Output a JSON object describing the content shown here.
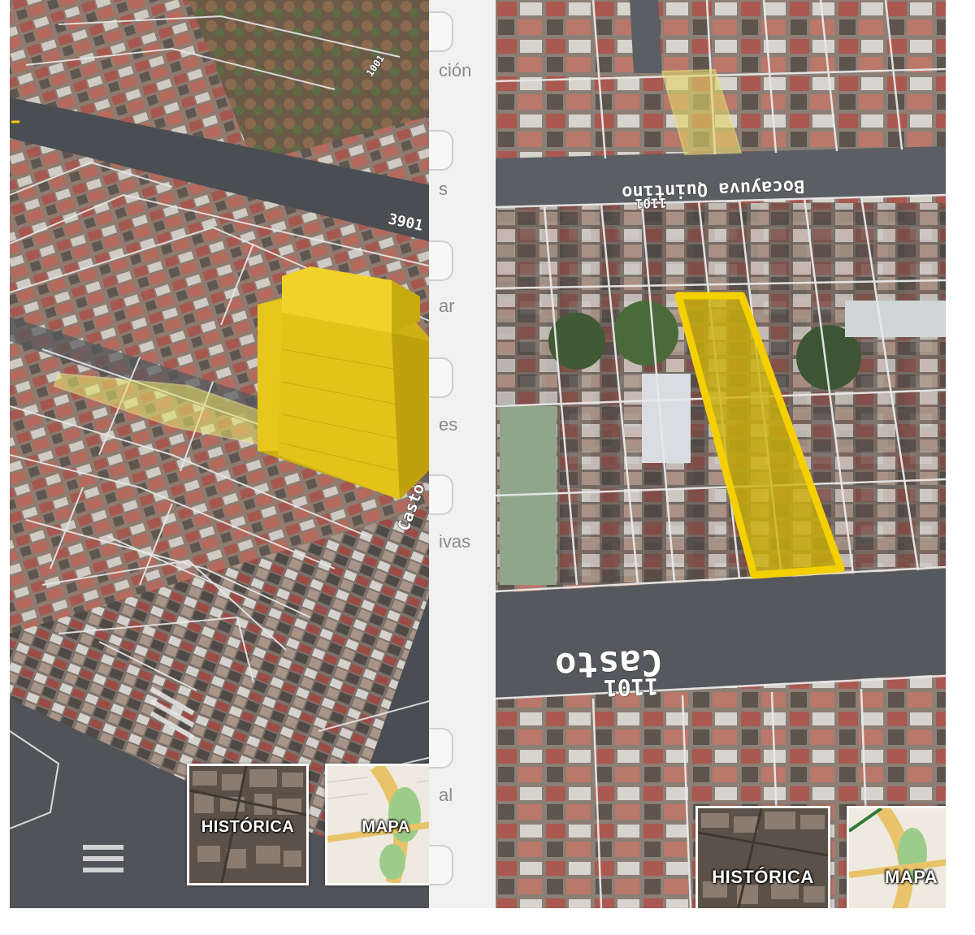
{
  "left": {
    "side_labels": [
      "ción",
      "s",
      "ar",
      "es",
      "ivas",
      "al"
    ],
    "street_labels": [
      "3901",
      "Casto",
      "1001"
    ],
    "layer_thumbs": [
      {
        "id": "historica",
        "label": "HISTÓRICA"
      },
      {
        "id": "mapa",
        "label": "MAPA"
      }
    ]
  },
  "right": {
    "street_labels": [
      "Bocayuva Quintino",
      "1101",
      "Casto",
      "1101"
    ],
    "layer_thumbs": [
      {
        "id": "historica",
        "label": "HISTÓRICA"
      },
      {
        "id": "mapa",
        "label": "MAPA"
      }
    ]
  },
  "colors": {
    "highlight": "#f5d000",
    "building": "#e3c51a",
    "parcel_line": "#e8e8e8",
    "street": "#4a4d52"
  },
  "icons": {
    "location_marker": "location-marker-icon"
  }
}
